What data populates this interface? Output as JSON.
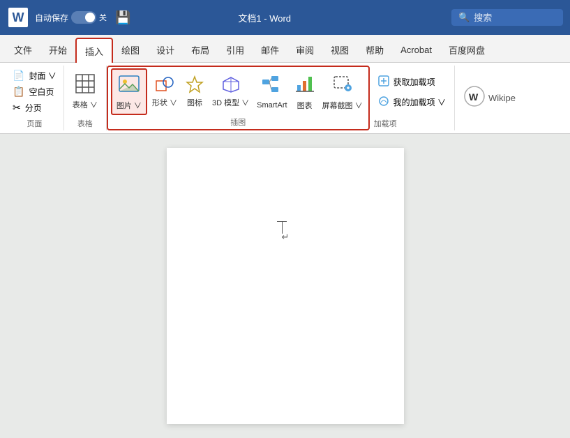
{
  "titleBar": {
    "autosave_label": "自动保存",
    "toggle_state": "关",
    "title": "文档1 - Word",
    "search_placeholder": "搜索"
  },
  "tabs": [
    {
      "id": "file",
      "label": "文件",
      "active": false
    },
    {
      "id": "home",
      "label": "开始",
      "active": false
    },
    {
      "id": "insert",
      "label": "插入",
      "active": true
    },
    {
      "id": "draw",
      "label": "绘图",
      "active": false
    },
    {
      "id": "design",
      "label": "设计",
      "active": false
    },
    {
      "id": "layout",
      "label": "布局",
      "active": false
    },
    {
      "id": "references",
      "label": "引用",
      "active": false
    },
    {
      "id": "mail",
      "label": "邮件",
      "active": false
    },
    {
      "id": "review",
      "label": "审阅",
      "active": false
    },
    {
      "id": "view",
      "label": "视图",
      "active": false
    },
    {
      "id": "help",
      "label": "帮助",
      "active": false
    },
    {
      "id": "acrobat",
      "label": "Acrobat",
      "active": false
    },
    {
      "id": "baiduyun",
      "label": "百度网盘",
      "active": false
    }
  ],
  "ribbon": {
    "groups": [
      {
        "id": "pages",
        "label": "页面",
        "items": [
          {
            "icon": "📄",
            "label": "封面",
            "hasDropdown": true
          },
          {
            "icon": "📄",
            "label": "空白页"
          },
          {
            "icon": "✂",
            "label": "分页"
          }
        ]
      },
      {
        "id": "table",
        "label": "表格",
        "items": [
          {
            "icon": "⊞",
            "label": "表格",
            "hasDropdown": true
          }
        ]
      },
      {
        "id": "illustrations",
        "label": "插图",
        "items": [
          {
            "icon": "🖼",
            "label": "图片",
            "highlighted": true
          },
          {
            "icon": "⬡",
            "label": "形状",
            "hasDropdown": true
          },
          {
            "icon": "⭐",
            "label": "图标"
          },
          {
            "icon": "🎲",
            "label": "3D 模型",
            "hasDropdown": true
          },
          {
            "icon": "🔷",
            "label": "SmartArt"
          },
          {
            "icon": "📊",
            "label": "图表"
          },
          {
            "icon": "📸",
            "label": "屏幕截图",
            "hasDropdown": true
          }
        ]
      },
      {
        "id": "addins",
        "label": "加载项",
        "items": [
          {
            "icon": "🔧",
            "label": "获取加载项"
          },
          {
            "icon": "☁",
            "label": "我的加载项",
            "hasDropdown": true
          }
        ]
      },
      {
        "id": "wiki",
        "label": "",
        "items": [
          {
            "label": "Wikipe"
          }
        ]
      }
    ]
  },
  "document": {
    "page_bg": "white"
  }
}
